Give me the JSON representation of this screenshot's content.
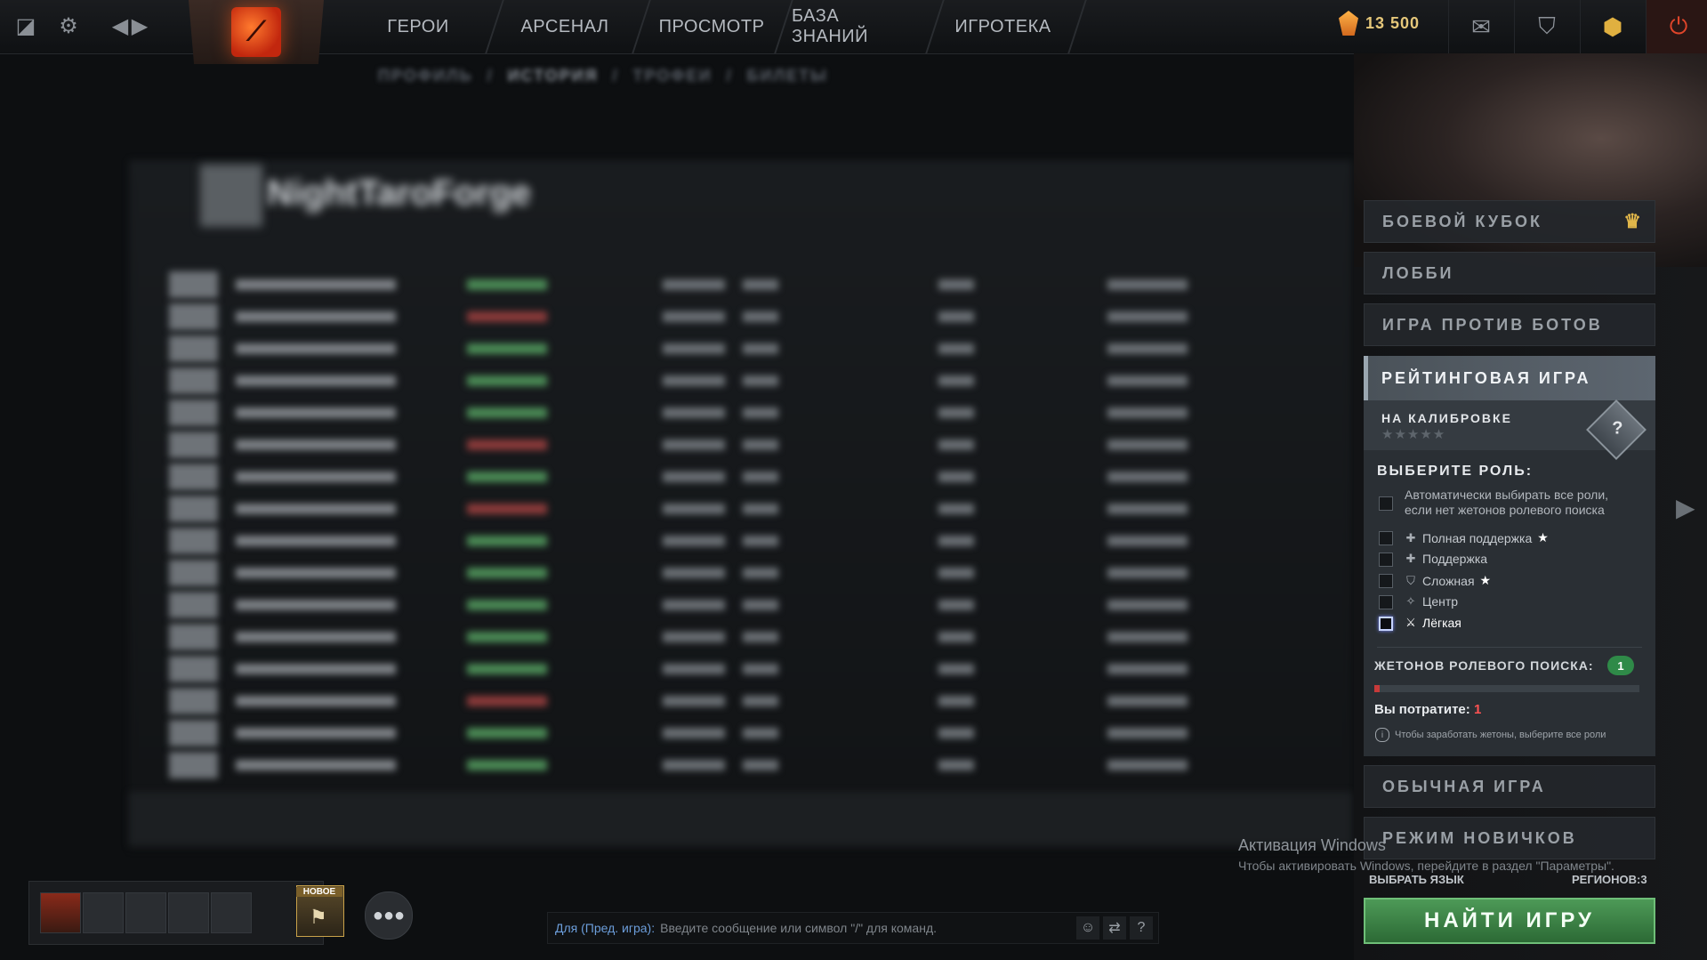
{
  "topbar": {
    "nav": [
      "ГЕРОИ",
      "АРСЕНАЛ",
      "ПРОСМОТР",
      "БАЗА ЗНАНИЙ",
      "ИГРОТЕКА"
    ],
    "currency": "13 500"
  },
  "profile": {
    "subnav": [
      "ПРОФИЛЬ",
      "/",
      "ИСТОРИЯ",
      "/",
      "ТРОФЕИ",
      "/",
      "БИЛЕТЫ"
    ],
    "player_name": "NightTaroForge"
  },
  "sidebar": {
    "battle_cup": "БОЕВОЙ КУБОК",
    "lobby": "ЛОББИ",
    "bots": "ИГРА ПРОТИВ БОТОВ",
    "ranked": {
      "title": "РЕЙТИНГОВАЯ ИГРА",
      "calibration": "НА КАЛИБРОВКЕ",
      "stars": "★★★★★",
      "medal": "?",
      "choose_role": "ВЫБЕРИТЕ РОЛЬ:",
      "auto_text": "Автоматически выбирать все роли, если нет жетонов ролевого поиска",
      "roles": [
        "Полная поддержка",
        "Поддержка",
        "Сложная",
        "Центр",
        "Лёгкая"
      ],
      "tokens_label": "ЖЕТОНОВ РОЛЕВОГО ПОИСКА:",
      "tokens_value": "1",
      "spend_label": "Вы потратите:",
      "spend_value": "1",
      "hint": "Чтобы заработать жетоны, выберите все роли",
      "token_fill": 0.02
    },
    "normal": "ОБЫЧНАЯ ИГРА",
    "newbie": "РЕЖИМ НОВИЧКОВ",
    "language": "ВЫБРАТЬ ЯЗЫК",
    "regions": "РЕГИОНОВ:3",
    "find_game": "НАЙТИ ИГРУ"
  },
  "windows_notice": {
    "title": "Активация Windows",
    "subtitle": "Чтобы активировать Windows, перейдите в раздел \"Параметры\"."
  },
  "party": {
    "new_label": "НОВОЕ"
  },
  "chat": {
    "channel": "Для (Пред. игра):",
    "placeholder": "Введите сообщение или символ \"/\" для команд.",
    "help": "?"
  }
}
